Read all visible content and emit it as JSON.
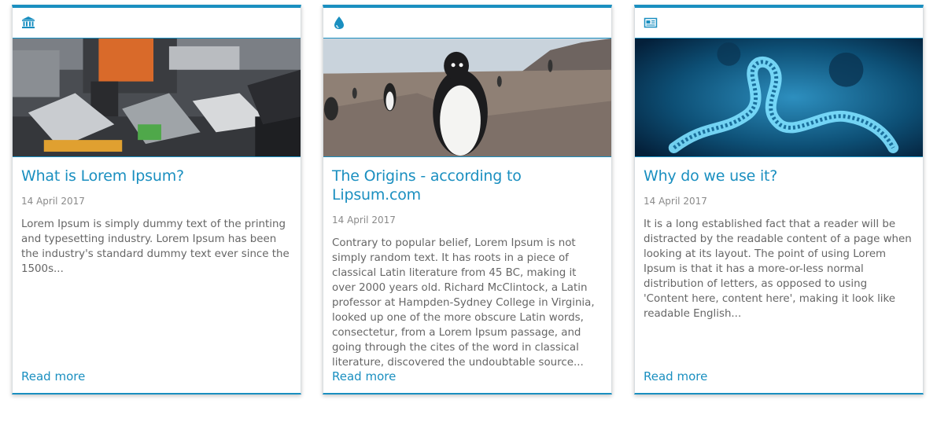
{
  "colors": {
    "accent": "#1a8fc0",
    "text": "#666666",
    "date": "#8a8a8a"
  },
  "cards": [
    {
      "icon": "bank-icon",
      "title": "What is Lorem Ipsum?",
      "date": "14 April 2017",
      "text": "Lorem Ipsum is simply dummy text of the printing and typesetting industry. Lorem Ipsum has been the industry's standard dummy text ever since the 1500s...",
      "read_more": "Read more"
    },
    {
      "icon": "water-drop-icon",
      "title": "The Origins - according to Lipsum.com",
      "date": "14 April 2017",
      "text": "Contrary to popular belief, Lorem Ipsum is not simply random text. It has roots in a piece of classical Latin literature from 45 BC, making it over 2000 years old. Richard McClintock, a Latin professor at Hampden-Sydney College in Virginia, looked up one of the more obscure Latin words, consectetur, from a Lorem Ipsum passage, and going through the cites of the word in classical literature, discovered the undoubtable source...",
      "read_more": "Read more"
    },
    {
      "icon": "newspaper-icon",
      "title": "Why do we use it?",
      "date": "14 April 2017",
      "text": "It is a long established fact that a reader will be distracted by the readable content of a page when looking at its layout. The point of using Lorem Ipsum is that it has a more-or-less normal distribution of letters, as opposed to using 'Content here, content here', making it look like readable English...",
      "read_more": "Read more"
    }
  ]
}
